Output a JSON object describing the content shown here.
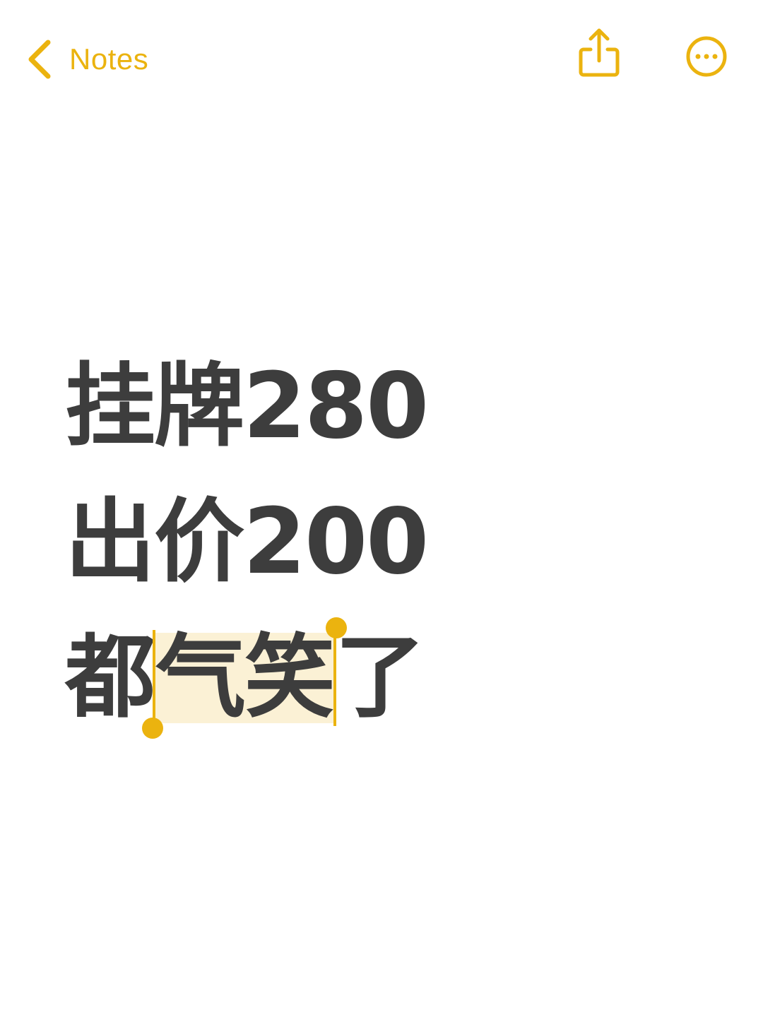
{
  "nav": {
    "back_label": "Notes",
    "share_icon": "share-icon",
    "more_icon": "ellipsis-circle-icon"
  },
  "note": {
    "lines": [
      "挂牌280",
      "出价200"
    ],
    "line3": {
      "before": "都",
      "selected": "气笑",
      "after": "了"
    }
  },
  "colors": {
    "accent": "#EBB30F",
    "text": "#3D3D3D",
    "selection": "#FBF1D5",
    "background": "#FFFFFF"
  }
}
